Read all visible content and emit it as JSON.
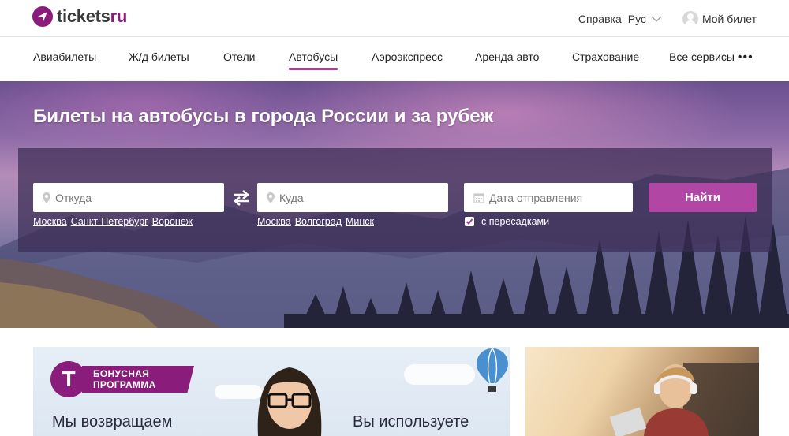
{
  "header": {
    "logo_part1": "tickets",
    "logo_part2": "ru",
    "help_label": "Справка",
    "language": "Рус",
    "account_label": "Мой билет"
  },
  "nav": {
    "items": [
      {
        "label": "Авиабилеты"
      },
      {
        "label": "Ж/д билеты"
      },
      {
        "label": "Отели"
      },
      {
        "label": "Автобусы",
        "active": true
      },
      {
        "label": "Аэроэкспресс"
      },
      {
        "label": "Аренда авто"
      },
      {
        "label": "Страхование"
      },
      {
        "label": "Все сервисы"
      }
    ],
    "more_icon": "•••"
  },
  "hero": {
    "title": "Билеты на автобусы в города России и за рубеж"
  },
  "search": {
    "from_placeholder": "Откуда",
    "to_placeholder": "Куда",
    "date_placeholder": "Дата отправления",
    "from_quick": [
      "Москва",
      "Санкт-Петербург",
      "Воронеж"
    ],
    "to_quick": [
      "Москва",
      "Волгоград",
      "Минск"
    ],
    "transfers_label": "с пересадками",
    "transfers_checked": true,
    "submit_label": "Найти"
  },
  "promo": {
    "badge_letter": "T",
    "badge_line1": "БОНУСНАЯ",
    "badge_line2": "ПРОГРАММА",
    "text_left": "Мы возвращаем",
    "text_right": "Вы используете"
  },
  "colors": {
    "brand": "#8a1c7c",
    "button": "#b246a5",
    "nav_active_underline": "#a0408f"
  }
}
